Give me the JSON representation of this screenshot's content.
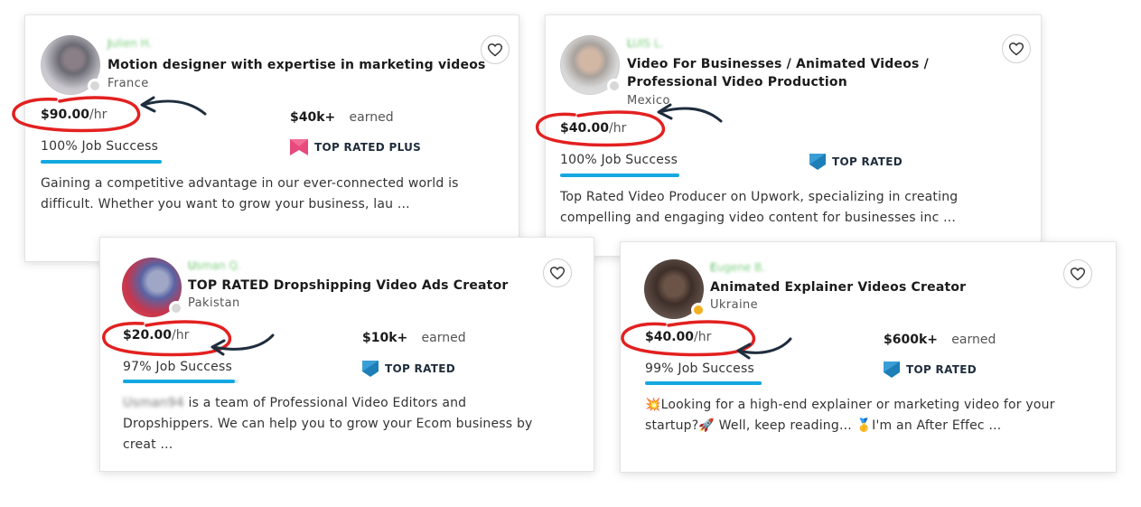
{
  "colors": {
    "highlight": "#e32020",
    "arrow": "#1f2d3d",
    "success_bar": "#14a8e1",
    "plus_badge": "#e84a7c",
    "rated_badge": "#1e7fb8",
    "name_green": "#4bb34f"
  },
  "cards": [
    {
      "name_first": "J",
      "name_rest": "ulien H.",
      "title_lines": [
        "Motion designer with expertise in marketing videos"
      ],
      "country": "France",
      "rate": "$90.00",
      "rate_unit": "/hr",
      "earned_amount": "$40k+",
      "earned_label": "earned",
      "job_success": "100% Job Success",
      "job_success_pct": 100,
      "badge_label": "TOP RATED PLUS",
      "badge_icon": "top-rated-plus-icon",
      "desc_lines": [
        "Gaining a competitive advantage in our ever-connected world is",
        "difficult. Whether you want to grow your business, lau ..."
      ],
      "status": "offline"
    },
    {
      "name_first": "L",
      "name_rest": "UIS L.",
      "title_lines": [
        "Video For Businesses / Animated Videos /",
        "Professional Video Production"
      ],
      "country": "Mexico",
      "rate": "$40.00",
      "rate_unit": "/hr",
      "earned_amount": "",
      "earned_label": "",
      "job_success": "100% Job Success",
      "job_success_pct": 100,
      "badge_label": "TOP RATED",
      "badge_icon": "top-rated-icon",
      "desc_lines": [
        "Top Rated Video Producer on Upwork, specializing in creating",
        "compelling and engaging video content for businesses inc ..."
      ],
      "status": "offline"
    },
    {
      "name_first": "U",
      "name_rest": "sman Q.",
      "title_lines": [
        "TOP RATED Dropshipping Video Ads Creator"
      ],
      "country": "Pakistan",
      "rate": "$20.00",
      "rate_unit": "/hr",
      "earned_amount": "$10k+",
      "earned_label": "earned",
      "job_success": "97% Job Success",
      "job_success_pct": 97,
      "badge_label": "TOP RATED",
      "badge_icon": "top-rated-icon",
      "desc_blur": "Usman94",
      "desc_lines": [
        " is a team of Professional Video Editors and",
        "Dropshippers. We can help you to grow your Ecom business by",
        "creat ..."
      ],
      "status": "offline"
    },
    {
      "name_first": "E",
      "name_rest": "ugene B.",
      "title_lines": [
        "Animated Explainer Videos Creator"
      ],
      "country": "Ukraine",
      "rate": "$40.00",
      "rate_unit": "/hr",
      "earned_amount": "$600k+",
      "earned_label": "earned",
      "job_success": "99% Job Success",
      "job_success_pct": 99,
      "badge_label": "TOP RATED",
      "badge_icon": "top-rated-icon",
      "desc_lines": [
        "💥Looking for a high-end explainer or marketing video for your",
        "startup?🚀 Well, keep reading... 🥇I'm an After Effec ..."
      ],
      "status": "away"
    }
  ]
}
